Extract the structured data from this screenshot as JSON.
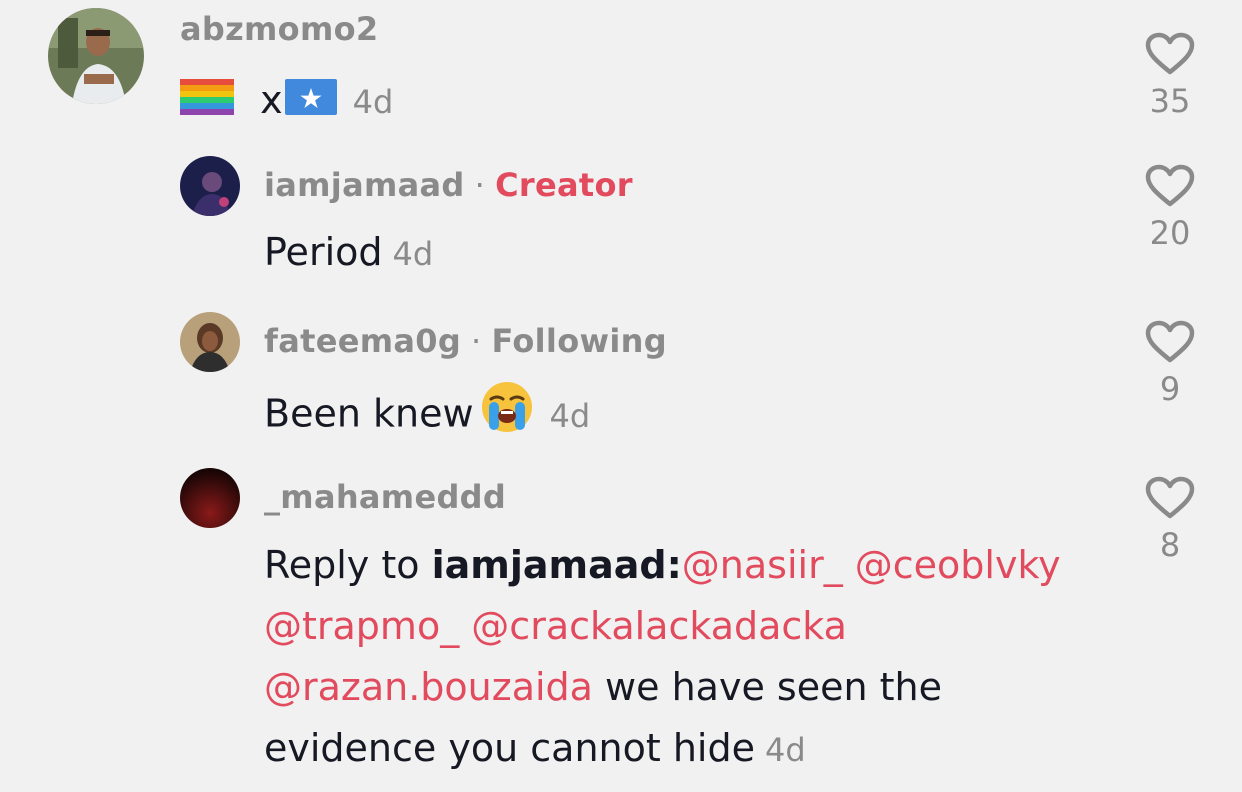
{
  "comments": [
    {
      "username": "abzmomo2",
      "text_separator": "x",
      "time": "4d",
      "likes": "35"
    },
    {
      "username": "iamjamaad",
      "badge": "Creator",
      "text": "Period",
      "time": "4d",
      "likes": "20"
    },
    {
      "username": "fateema0g",
      "badge": "Following",
      "text": "Been knew",
      "time": "4d",
      "likes": "9"
    },
    {
      "username": "_mahameddd",
      "reply_prefix": "Reply to ",
      "reply_to": "iamjamaad:",
      "mentions": [
        "@nasiir_",
        "@ceoblvky",
        "@trapmo_",
        "@crackalackadacka",
        "@razan.bouzaida"
      ],
      "text_tail_1": " we have seen the",
      "text_tail_2": "evidence you cannot hide",
      "time": "4d",
      "likes": "8"
    }
  ],
  "icons": {
    "like": "heart-outline-icon",
    "flag_1": "rainbow-flag-icon",
    "flag_2": "somalia-flag-icon",
    "emoji": "loudly-crying-face-icon"
  },
  "colors": {
    "background": "#f1f1f1",
    "text": "#161823",
    "muted": "#8a8a8a",
    "accent": "#e24a5e"
  }
}
